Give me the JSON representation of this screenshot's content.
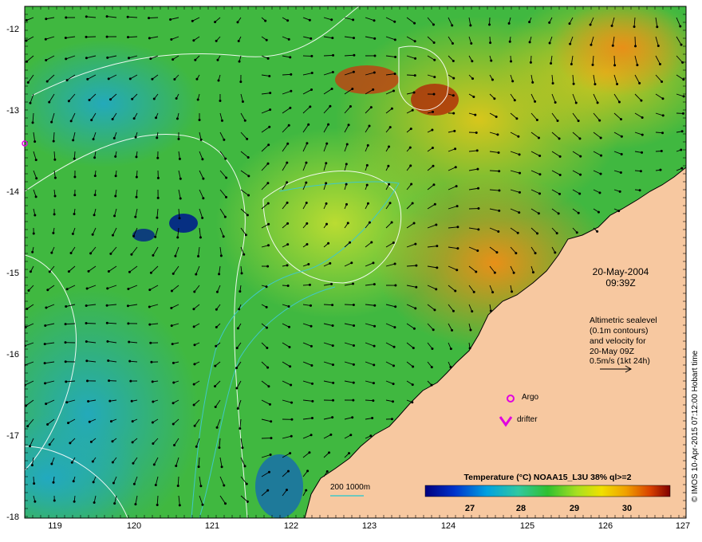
{
  "map": {
    "lon_range": [
      118.6,
      127
    ],
    "lat_range": [
      -18,
      -11.8
    ],
    "lon_ticks": [
      "119",
      "120",
      "121",
      "122",
      "123",
      "124",
      "125",
      "126",
      "127"
    ],
    "lat_ticks": [
      "-12",
      "-13",
      "-14",
      "-15",
      "-16",
      "-17",
      "-18"
    ]
  },
  "info": {
    "date": "20-May-2004",
    "time": "09:39Z",
    "alt_line1": "Altimetric sealevel",
    "alt_line2": "(0.1m contours)",
    "alt_line3": "and velocity for",
    "alt_line4": "20-May 09Z",
    "alt_line5": "0.5m/s (1kt 24h)"
  },
  "markers": {
    "argo_label": "Argo",
    "drifter_label": "drifter"
  },
  "bathy_label": "200  1000m",
  "colorbar": {
    "title": "Temperature (°C) NOAA15_L3U 38% ql>=2",
    "min": 26.6,
    "max": 30.9,
    "ticks": [
      "27",
      "28",
      "29",
      "30"
    ]
  },
  "credit": "© IMOS 10-Apr-2015 07:12:00 Hobart time",
  "colors": {
    "land": "#F7C8A0",
    "argo": "#E000E0",
    "drifter": "#E000E0",
    "bathy": "#40C8C8"
  }
}
